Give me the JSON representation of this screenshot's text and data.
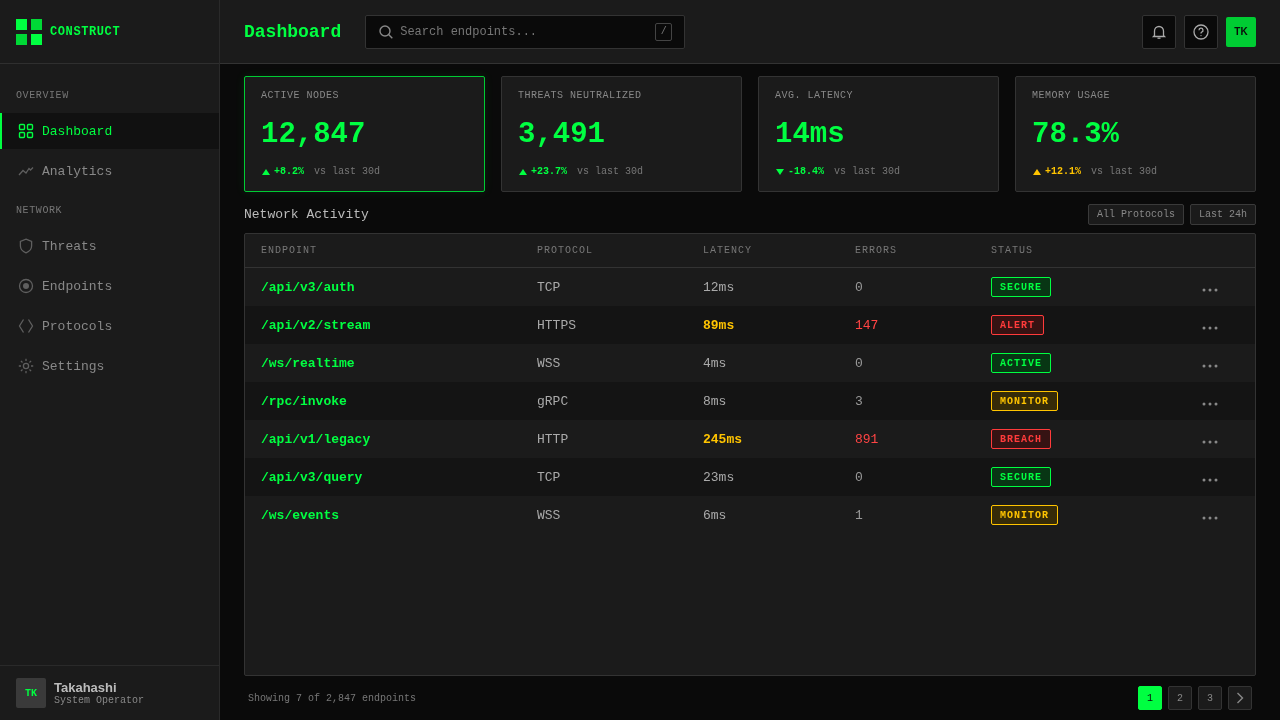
{
  "sidebar": {
    "brand": "CONSTRUCT",
    "sections": [
      {
        "label": "OVERVIEW",
        "items": [
          {
            "label": "Dashboard",
            "selected": true
          },
          {
            "label": "Analytics",
            "selected": false
          }
        ]
      },
      {
        "label": "NETWORK",
        "items": [
          {
            "label": "Threats",
            "selected": false
          },
          {
            "label": "Endpoints",
            "selected": false
          },
          {
            "label": "Protocols",
            "selected": false
          },
          {
            "label": "Settings",
            "selected": false
          }
        ]
      }
    ],
    "user": {
      "initials": "TK",
      "name": "Takahashi",
      "role": "System Operator"
    }
  },
  "header": {
    "title": "Dashboard",
    "search": {
      "placeholder": "Search endpoints...",
      "shortcut": "/"
    },
    "avatar": "TK"
  },
  "stats": [
    {
      "label": "ACTIVE NODES",
      "value": "12,847",
      "change": "+8.2%",
      "rising": true,
      "warning": false,
      "note": "vs last 30d",
      "highlighted": true
    },
    {
      "label": "THREATS NEUTRALIZED",
      "value": "3,491",
      "change": "+23.7%",
      "rising": true,
      "warning": false,
      "note": "vs last 30d",
      "highlighted": false
    },
    {
      "label": "AVG. LATENCY",
      "value": "14ms",
      "change": "-18.4%",
      "rising": false,
      "warning": false,
      "note": "vs last 30d",
      "highlighted": false
    },
    {
      "label": "MEMORY USAGE",
      "value": "78.3%",
      "change": "+12.1%",
      "rising": true,
      "warning": true,
      "note": "vs last 30d",
      "highlighted": false
    }
  ],
  "activity": {
    "title": "Network Activity",
    "filters": [
      "All Protocols",
      "Last 24h"
    ],
    "table": {
      "columns": [
        "ENDPOINT",
        "PROTOCOL",
        "LATENCY",
        "ERRORS",
        "STATUS"
      ],
      "rows": [
        {
          "endpoint": "/api/v3/auth",
          "protocol": "TCP",
          "latency": "12ms",
          "latency_high": false,
          "errors": "0",
          "errors_high": false,
          "status": {
            "label": "SECURE",
            "color": "#00ff41"
          }
        },
        {
          "endpoint": "/api/v2/stream",
          "protocol": "HTTPS",
          "latency": "89ms",
          "latency_high": true,
          "errors": "147",
          "errors_high": true,
          "status": {
            "label": "ALERT",
            "color": "#ff3b3b"
          }
        },
        {
          "endpoint": "/ws/realtime",
          "protocol": "WSS",
          "latency": "4ms",
          "latency_high": false,
          "errors": "0",
          "errors_high": false,
          "status": {
            "label": "ACTIVE",
            "color": "#00ff41"
          }
        },
        {
          "endpoint": "/rpc/invoke",
          "protocol": "gRPC",
          "latency": "8ms",
          "latency_high": false,
          "errors": "3",
          "errors_high": false,
          "status": {
            "label": "MONITOR",
            "color": "#ffc400"
          }
        },
        {
          "endpoint": "/api/v1/legacy",
          "protocol": "HTTP",
          "latency": "245ms",
          "latency_high": true,
          "errors": "891",
          "errors_high": true,
          "status": {
            "label": "BREACH",
            "color": "#ff3b3b"
          }
        },
        {
          "endpoint": "/api/v3/query",
          "protocol": "TCP",
          "latency": "23ms",
          "latency_high": false,
          "errors": "0",
          "errors_high": false,
          "status": {
            "label": "SECURE",
            "color": "#00ff41"
          }
        },
        {
          "endpoint": "/ws/events",
          "protocol": "WSS",
          "latency": "6ms",
          "latency_high": false,
          "errors": "1",
          "errors_high": false,
          "status": {
            "label": "MONITOR",
            "color": "#ffc400"
          }
        }
      ]
    },
    "summary": "Showing 7 of 2,847 endpoints",
    "pages": [
      {
        "label": "1",
        "selected": true
      },
      {
        "label": "2",
        "selected": false
      },
      {
        "label": "3",
        "selected": false
      }
    ]
  }
}
